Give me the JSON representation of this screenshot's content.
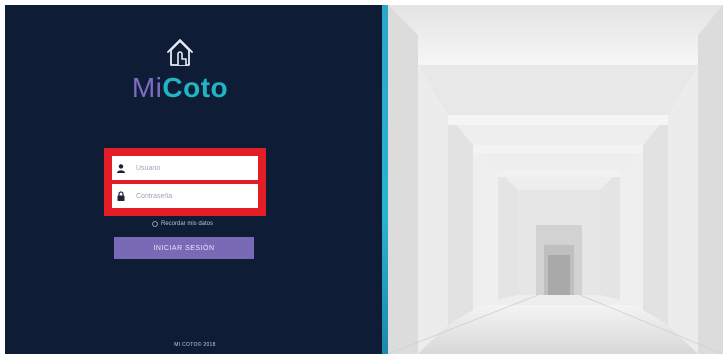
{
  "brand": {
    "name_part1": "Mi",
    "name_part2": "Coto"
  },
  "login": {
    "username_placeholder": "Usuario",
    "password_placeholder": "Contraseña",
    "forgot_text": "Recordar mis datos",
    "submit_label": "INICIAR SESIÓN"
  },
  "footer": {
    "copyright": "MI COTO© 2018"
  },
  "colors": {
    "panel": "#0f1c36",
    "accent": "#2ab3d0",
    "button": "#7a6ab6",
    "highlight": "#e41e26"
  },
  "icons": [
    "house-hand-icon",
    "user-icon",
    "lock-icon"
  ]
}
